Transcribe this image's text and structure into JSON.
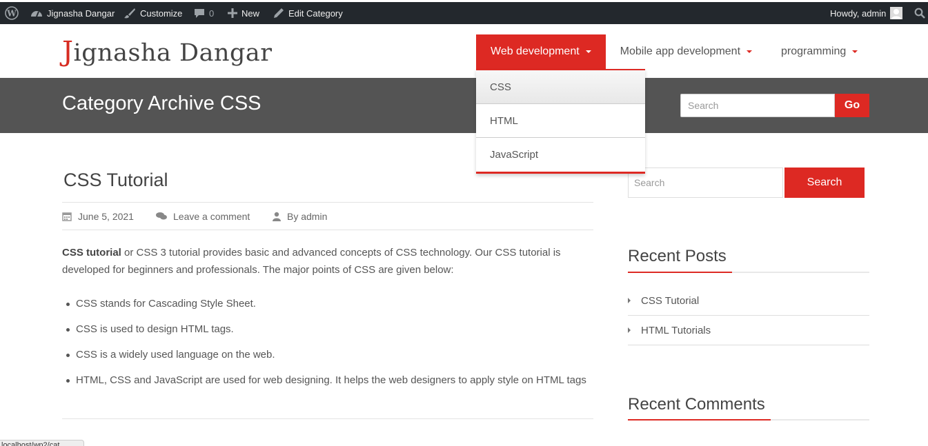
{
  "admin_bar": {
    "site_name": "Jignasha Dangar",
    "customize": "Customize",
    "comments_count": "0",
    "new": "New",
    "edit": "Edit Category",
    "greeting": "Howdy, admin"
  },
  "site": {
    "title_initial": "J",
    "title_rest": "ignasha Dangar"
  },
  "nav": {
    "items": [
      {
        "label": "Web development"
      },
      {
        "label": "Mobile app development"
      },
      {
        "label": "programming"
      }
    ],
    "dropdown": [
      "CSS",
      "HTML",
      "JavaScript"
    ]
  },
  "page": {
    "archive_title": "Category Archive CSS",
    "search_placeholder": "Search",
    "go_label": "Go"
  },
  "post": {
    "title": "CSS Tutorial",
    "date": "June 5, 2021",
    "comment_link": "Leave a comment",
    "author": "By admin",
    "intro_bold": "CSS tutorial",
    "intro_rest": " or CSS 3 tutorial provides basic and advanced concepts of CSS technology. Our CSS tutorial is developed for beginners and professionals. The major points of CSS are given below:",
    "bullets": [
      "CSS stands for Cascading Style Sheet.",
      "CSS is used to design HTML tags.",
      "CSS is a widely used language on the web.",
      "HTML, CSS and JavaScript are used for web designing. It helps the web designers to apply style on HTML tags"
    ]
  },
  "sidebar": {
    "search_placeholder": "Search",
    "search_button": "Search",
    "recent_posts_title": "Recent Posts",
    "recent_posts": [
      "CSS Tutorial",
      "HTML Tutorials"
    ],
    "recent_comments_title": "Recent Comments"
  },
  "status_bar": {
    "url": "localhost/wp2/cat..."
  },
  "colors": {
    "accent": "#dd2923",
    "admin_bar": "#23282d",
    "band": "#545454"
  }
}
